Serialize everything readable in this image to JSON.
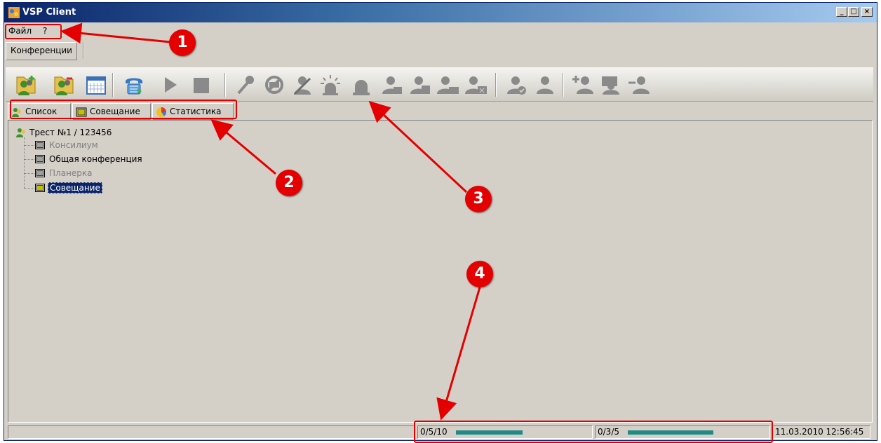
{
  "window": {
    "title": "VSP Client",
    "controls": [
      "_",
      "□",
      "×"
    ]
  },
  "menu": {
    "items": [
      "Файл",
      "?"
    ]
  },
  "top_tab": {
    "label": "Конференции"
  },
  "toolbar": {
    "buttons": [
      "add-user-icon",
      "remove-user-icon",
      "calendar-icon",
      "phone-icon",
      "play-icon",
      "stop-icon",
      "microphone-icon",
      "no-camera-icon",
      "participant-disabled-icon",
      "alarm-icon",
      "bell-icon",
      "participant-icon-1",
      "participant-icon-2",
      "participant-icon-3",
      "participant-icon-4",
      "participant-check-icon",
      "participant-icon-5",
      "add-participant-icon",
      "participants-group-icon",
      "remove-participant-icon"
    ]
  },
  "tabs": [
    {
      "label": "Список",
      "icon": "users-icon",
      "active": true
    },
    {
      "label": "Совещание",
      "icon": "window-icon",
      "active": false
    },
    {
      "label": "Статистика",
      "icon": "pie-chart-icon",
      "active": false
    }
  ],
  "tree": {
    "root": "Трест №1 / 123456",
    "items": [
      {
        "label": "Консилиум",
        "state": "disabled"
      },
      {
        "label": "Общая конференция",
        "state": "normal"
      },
      {
        "label": "Планерка",
        "state": "disabled"
      },
      {
        "label": "Совещание",
        "state": "selected"
      }
    ]
  },
  "status": {
    "counter1": "0/5/10",
    "progress1": 0.5,
    "counter2": "0/3/5",
    "progress2": 0.62,
    "datetime": "11.03.2010 12:56:45"
  },
  "annotations": [
    "1",
    "2",
    "3",
    "4"
  ],
  "colors": {
    "annotation": "#e40000",
    "title_bar": "#0a246a",
    "progress": "#1f8a86",
    "selection": "#0a246a"
  }
}
